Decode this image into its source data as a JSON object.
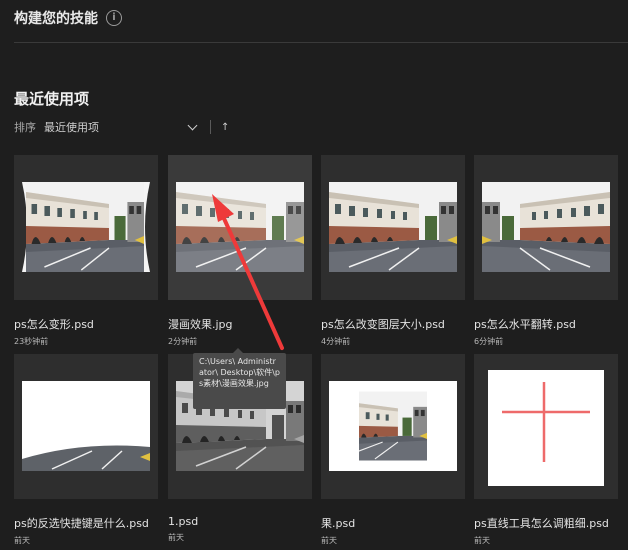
{
  "section": {
    "title": "构建您的技能",
    "info_icon": "info-icon"
  },
  "recent": {
    "title": "最近使用项",
    "sort_label": "排序",
    "sort_value": "最近使用项"
  },
  "files": [
    {
      "name": "ps怎么变形.psd",
      "time": "23秒钟前",
      "thumb": "warped-street"
    },
    {
      "name": "漫画效果.jpg",
      "time": "2分钟前",
      "thumb": "comic-street"
    },
    {
      "name": "ps怎么改变图层大小.psd",
      "time": "4分钟前",
      "thumb": "street"
    },
    {
      "name": "ps怎么水平翻转.psd",
      "time": "6分钟前",
      "thumb": "flipped-street"
    },
    {
      "name": "ps的反选快捷键是什么.psd",
      "time": "前天",
      "thumb": "white-with-road"
    },
    {
      "name": "1.psd",
      "time": "前天",
      "thumb": "gray-street"
    },
    {
      "name": "果.psd",
      "time": "前天",
      "thumb": "street-cropped"
    },
    {
      "name": "ps直线工具怎么调粗细.psd",
      "time": "前天",
      "thumb": "red-cross"
    }
  ],
  "tooltip": {
    "text": "C:\\Users\\ Administrator\\ Desktop\\软件\\ps素材\\漫画效果.jpg"
  },
  "colors": {
    "background": "#1e1e1e",
    "card": "#2e2e2e",
    "annotation_arrow": "#ee3a3a",
    "tooltip": "#4a4a4a"
  }
}
